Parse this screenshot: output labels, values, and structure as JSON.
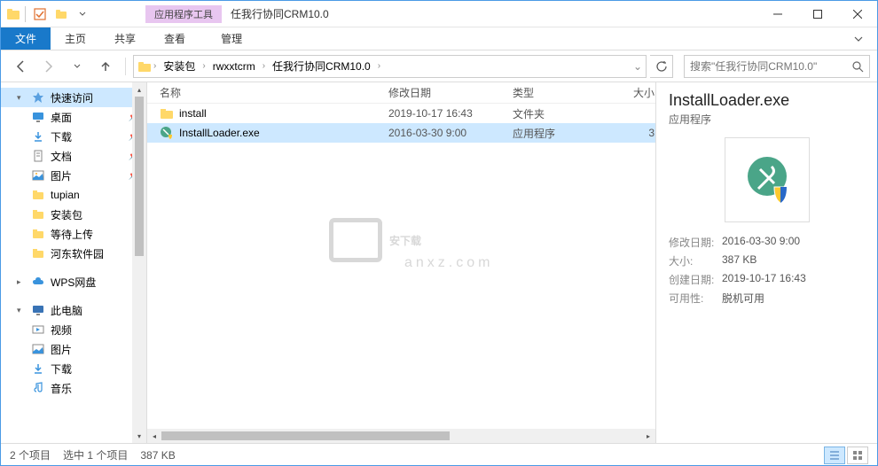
{
  "window": {
    "tool_context": "应用程序工具",
    "title": "任我行协同CRM10.0"
  },
  "ribbon": {
    "file": "文件",
    "home": "主页",
    "share": "共享",
    "view": "查看",
    "manage": "管理"
  },
  "breadcrumb": {
    "items": [
      "安装包",
      "rwxxtcrm",
      "任我行协同CRM10.0"
    ]
  },
  "search": {
    "placeholder": "搜索\"任我行协同CRM10.0\""
  },
  "nav": {
    "quick_access": "快速访问",
    "desktop": "桌面",
    "downloads": "下载",
    "documents": "文档",
    "pictures": "图片",
    "tupian": "tupian",
    "install_pkg": "安装包",
    "wait_upload": "等待上传",
    "hedong": "河东软件园",
    "wps": "WPS网盘",
    "this_pc": "此电脑",
    "videos": "视频",
    "pictures2": "图片",
    "downloads2": "下载",
    "music": "音乐"
  },
  "columns": {
    "name": "名称",
    "date": "修改日期",
    "type": "类型",
    "size": "大小"
  },
  "files": [
    {
      "name": "install",
      "date": "2019-10-17 16:43",
      "type": "文件夹",
      "size": "",
      "icon": "folder"
    },
    {
      "name": "InstallLoader.exe",
      "date": "2016-03-30 9:00",
      "type": "应用程序",
      "size": "3",
      "icon": "exe",
      "selected": true
    }
  ],
  "details": {
    "title": "InstallLoader.exe",
    "type": "应用程序",
    "modified_label": "修改日期:",
    "modified": "2016-03-30 9:00",
    "size_label": "大小:",
    "size": "387 KB",
    "created_label": "创建日期:",
    "created": "2019-10-17 16:43",
    "availability_label": "可用性:",
    "availability": "脱机可用"
  },
  "status": {
    "items": "2 个项目",
    "selected": "选中 1 个项目",
    "size": "387 KB"
  },
  "watermark": {
    "text": "安下载",
    "sub": "anxz.com"
  }
}
